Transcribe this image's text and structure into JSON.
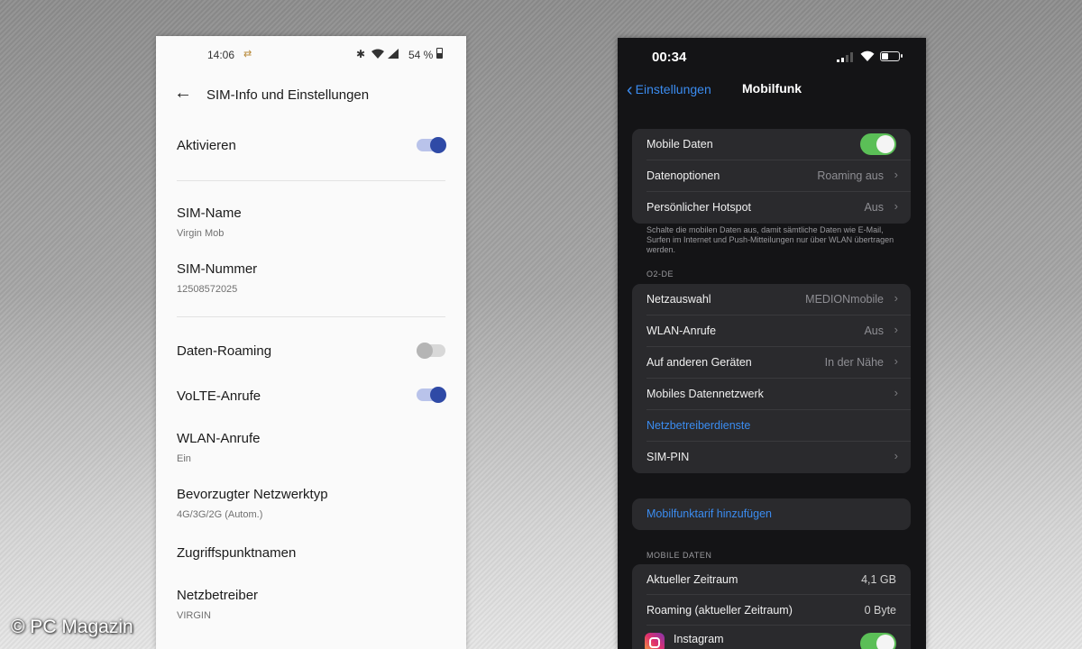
{
  "android": {
    "status": {
      "time": "14:06",
      "battery": "54 %"
    },
    "header": {
      "title": "SIM-Info und Einstellungen"
    },
    "activate": {
      "label": "Aktivieren",
      "enabled": true
    },
    "sim_name": {
      "label": "SIM-Name",
      "value": "Virgin Mob"
    },
    "sim_number": {
      "label": "SIM-Nummer",
      "value": "12508572025"
    },
    "data_roaming": {
      "label": "Daten-Roaming",
      "enabled": false
    },
    "volte": {
      "label": "VoLTE-Anrufe",
      "enabled": true
    },
    "wlan_calls": {
      "label": "WLAN-Anrufe",
      "value": "Ein"
    },
    "network_type": {
      "label": "Bevorzugter Netzwerktyp",
      "value": "4G/3G/2G (Autom.)"
    },
    "apn": {
      "label": "Zugriffspunktnamen"
    },
    "carrier": {
      "label": "Netzbetreiber",
      "value": "VIRGIN"
    },
    "colors": {
      "toggle_on": "#2f4aa6",
      "toggle_track_on": "#b9c3ea"
    }
  },
  "ios": {
    "status": {
      "time": "00:34"
    },
    "nav": {
      "back_label": "Einstellungen",
      "title": "Mobilfunk"
    },
    "group1": {
      "mobile_data": {
        "label": "Mobile Daten",
        "enabled": true
      },
      "data_options": {
        "label": "Datenoptionen",
        "value": "Roaming aus"
      },
      "hotspot": {
        "label": "Persönlicher Hotspot",
        "value": "Aus"
      }
    },
    "note": "Schalte die mobilen Daten aus, damit sämtliche Daten wie E-Mail, Surfen im Internet und Push-Mitteilungen nur über WLAN übertragen werden.",
    "carrier_section": "O2-DE",
    "group2": {
      "network_selection": {
        "label": "Netzauswahl",
        "value": "MEDIONmobile"
      },
      "wlan_calls": {
        "label": "WLAN-Anrufe",
        "value": "Aus"
      },
      "other_devices": {
        "label": "Auf anderen Geräten",
        "value": "In der Nähe"
      },
      "mobile_data_network": {
        "label": "Mobiles Datennetzwerk"
      },
      "carrier_services": {
        "label": "Netzbetreiberdienste"
      },
      "sim_pin": {
        "label": "SIM-PIN"
      }
    },
    "add_plan": {
      "label": "Mobilfunktarif hinzufügen"
    },
    "data_section": "MOBILE DATEN",
    "group3": {
      "current_period": {
        "label": "Aktueller Zeitraum",
        "value": "4,1 GB"
      },
      "roaming_period": {
        "label": "Roaming (aktueller Zeitraum)",
        "value": "0 Byte"
      },
      "instagram": {
        "label": "Instagram",
        "enabled": true
      }
    },
    "colors": {
      "accent": "#3b8cf0",
      "switch_on": "#5bbf57"
    }
  },
  "watermark": "© PC Magazin"
}
